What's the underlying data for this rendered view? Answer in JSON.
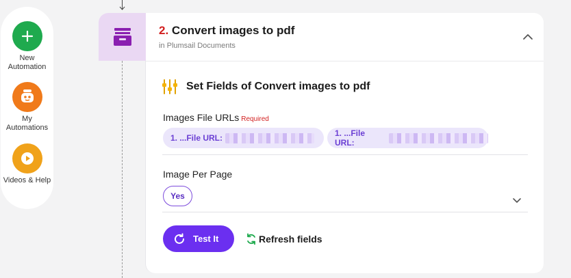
{
  "rail": {
    "items": [
      {
        "label": "New Automation",
        "icon": "plus-icon",
        "color": "#1faa4e"
      },
      {
        "label": "My Automations",
        "icon": "robot-icon",
        "color": "#f07a1a"
      },
      {
        "label": "Videos & Help",
        "icon": "play-icon",
        "color": "#f0a21a"
      }
    ]
  },
  "step": {
    "number": "2.",
    "title": "Convert images to pdf",
    "subtitle": "in Plumsail Documents",
    "app_icon": "archive-tray-icon",
    "accent": "#6b2ff0"
  },
  "section": {
    "title": "Set Fields of Convert images to pdf",
    "icon": "sliders-icon"
  },
  "fields": {
    "images": {
      "label": "Images File URLs",
      "required": "Required",
      "chips": [
        {
          "label": "1. ...File URL:"
        },
        {
          "label": "1. ...File URL:"
        }
      ]
    },
    "per_page": {
      "label": "Image Per Page",
      "value": "Yes"
    }
  },
  "actions": {
    "test": "Test It",
    "refresh": "Refresh fields"
  }
}
